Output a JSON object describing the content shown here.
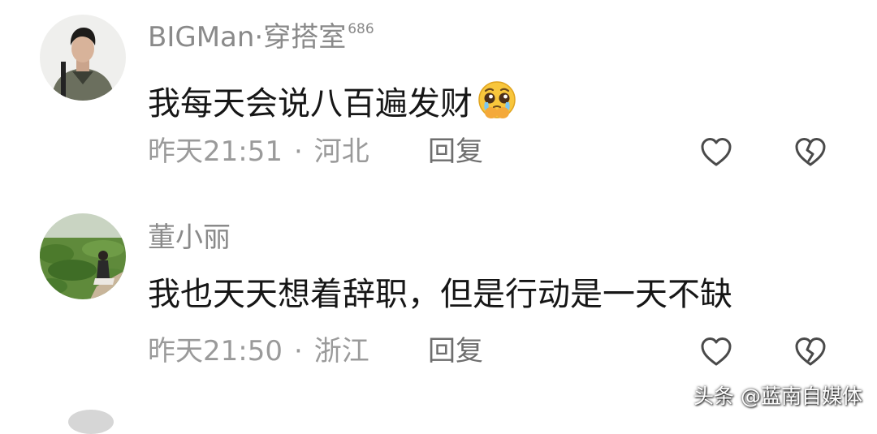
{
  "comments": [
    {
      "author": "BIGMan·穿搭室",
      "badge": "686",
      "content": "我每天会说八百遍发财",
      "emoji": "pleading-face-emoji",
      "time": "昨天21:51",
      "separator": "·",
      "location": "河北",
      "reply_label": "回复",
      "like_icon": "heart-outline-icon",
      "dislike_icon": "broken-heart-icon"
    },
    {
      "author": "董小丽",
      "content": "我也天天想着辞职，但是行动是一天不缺",
      "time": "昨天21:50",
      "separator": "·",
      "location": "浙江",
      "reply_label": "回复",
      "like_icon": "heart-outline-icon",
      "dislike_icon": "broken-heart-icon"
    }
  ],
  "watermark": "头条 @蓝南自媒体",
  "colors": {
    "author_text": "#8a8a8a",
    "body_text": "#161616",
    "meta_text": "#9a9a9a",
    "icon_stroke": "#4a4a4a"
  }
}
